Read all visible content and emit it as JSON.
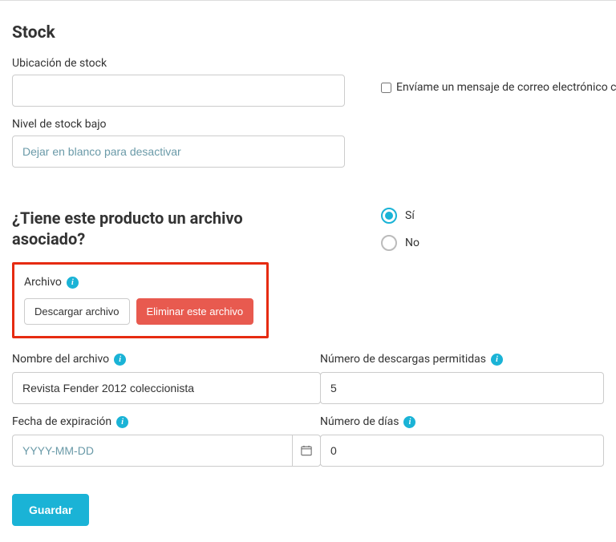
{
  "stock": {
    "heading": "Stock",
    "location_label": "Ubicación de stock",
    "location_value": "",
    "low_stock_label": "Nivel de stock bajo",
    "low_stock_placeholder": "Dejar en blanco para desactivar",
    "low_stock_value": "",
    "email_checkbox_label": "Envíame un mensaje de correo electrónico cu"
  },
  "file_section": {
    "question": "¿Tiene este producto un archivo asociado?",
    "radio": {
      "yes": "Sí",
      "no": "No"
    },
    "archivo_label": "Archivo",
    "download_btn": "Descargar archivo",
    "delete_btn": "Eliminar este archivo",
    "filename_label": "Nombre del archivo",
    "filename_value": "Revista Fender 2012 coleccionista",
    "downloads_label": "Número de descargas permitidas",
    "downloads_value": "5",
    "expiration_label": "Fecha de expiración",
    "expiration_placeholder": "YYYY-MM-DD",
    "expiration_value": "",
    "days_label": "Número de días",
    "days_value": "0"
  },
  "actions": {
    "save": "Guardar"
  }
}
